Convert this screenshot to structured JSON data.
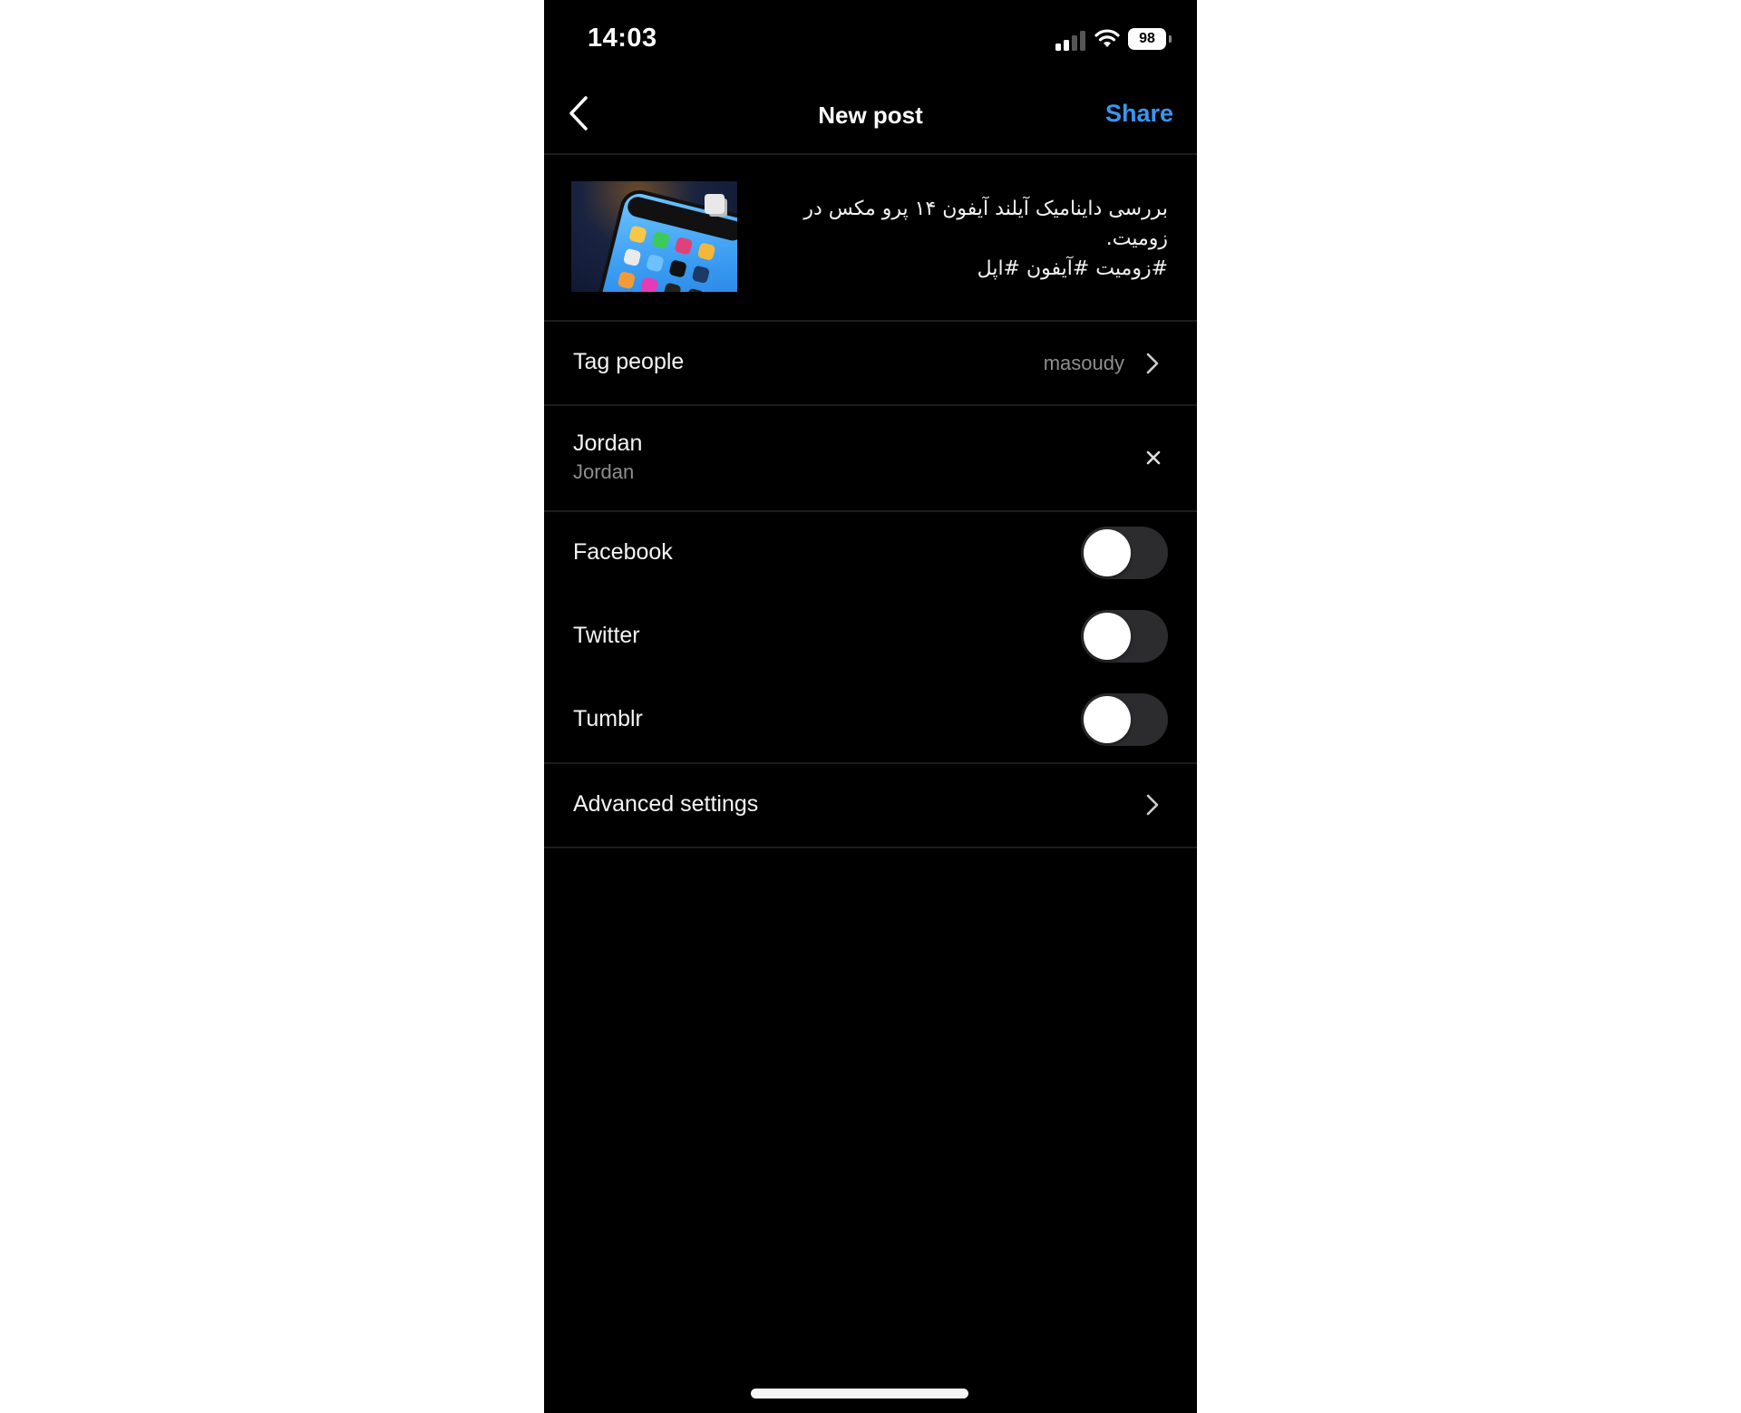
{
  "status_bar": {
    "time": "14:03",
    "signal_bars_filled": 2,
    "signal_bars_total": 4,
    "battery_percent": "98",
    "icons": [
      "cellular-signal-icon",
      "wifi-icon",
      "battery-icon"
    ]
  },
  "header": {
    "back_icon": "chevron-left-icon",
    "title": "New post",
    "share_label": "Share"
  },
  "post": {
    "thumbnail_alt": "iPhone 14 Pro Max dynamic island photo",
    "multi_media_icon": "carousel-icon",
    "caption_lines": [
      "بررسی داینامیک آیلند آیفون ۱۴ پرو مکس در",
      "زومیت.",
      "#زومیت #آیفون #اپل"
    ]
  },
  "tag_people": {
    "label": "Tag people",
    "value": "masoudy",
    "icon": "chevron-right-icon"
  },
  "location": {
    "title": "Jordan",
    "subtitle": "Jordan",
    "remove_icon": "close-icon"
  },
  "share_to": [
    {
      "label": "Facebook",
      "enabled": false
    },
    {
      "label": "Twitter",
      "enabled": false
    },
    {
      "label": "Tumblr",
      "enabled": false
    }
  ],
  "advanced": {
    "label": "Advanced settings",
    "icon": "chevron-right-icon"
  },
  "colors": {
    "background": "#000000",
    "accent": "#3897f0",
    "secondary_text": "#8e8e8e",
    "toggle_off_track": "#2c2c2e",
    "separator": "#1c1c1e"
  }
}
